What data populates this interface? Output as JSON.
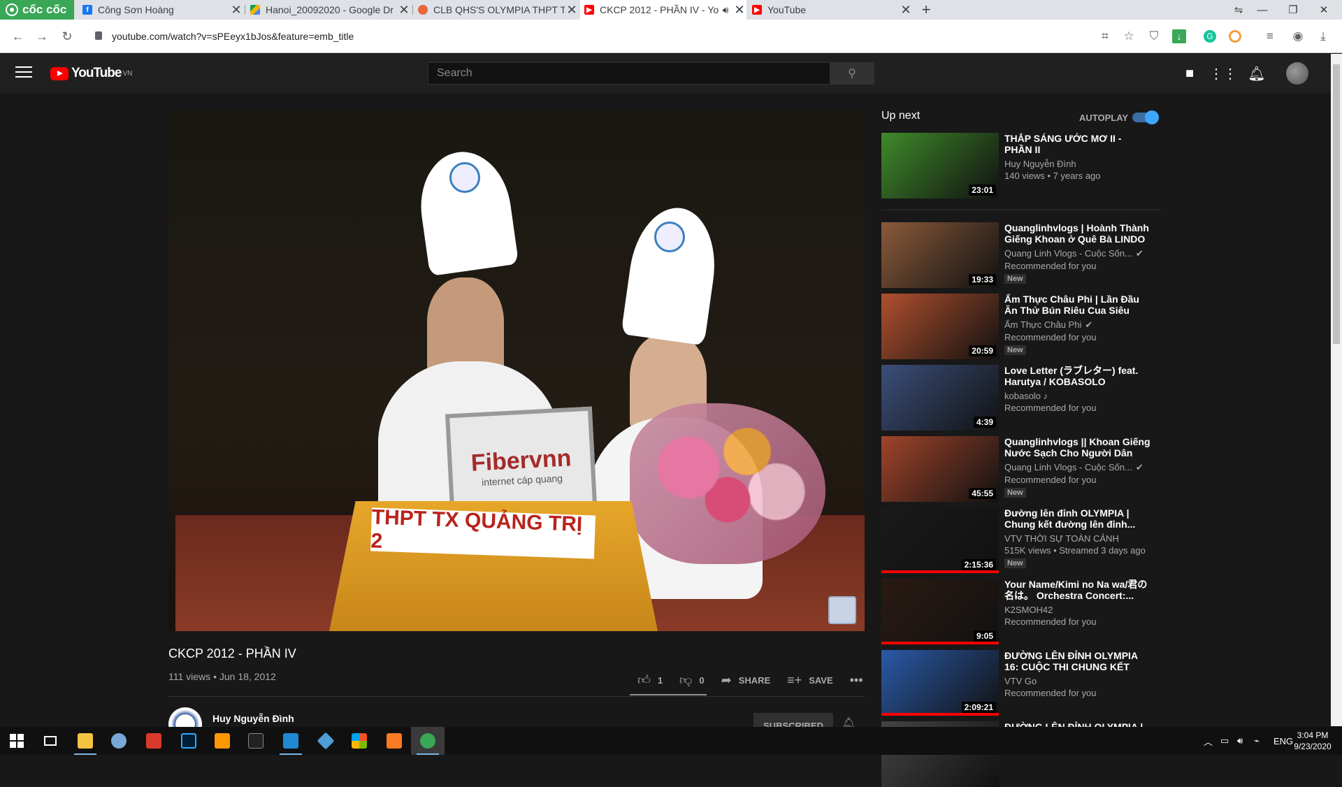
{
  "browser": {
    "brand": "cốc cốc",
    "tabs": [
      {
        "title": "Công Sơn Hoàng",
        "favicon": "facebook-icon",
        "color": "#1877f2"
      },
      {
        "title": "Hanoi_20092020 - Google Dr",
        "favicon": "google-drive-icon",
        "color": "#f4b400"
      },
      {
        "title": "CLB QHS'S OLYMPIA THPT TX",
        "favicon": "chrome-web-icon",
        "color": "#e8663d"
      },
      {
        "title": "CKCP 2012 - PHẦN IV - Yo",
        "favicon": "youtube-icon",
        "color": "#ff0000",
        "active": true
      },
      {
        "title": "YouTube",
        "favicon": "youtube-icon",
        "color": "#ff0000"
      }
    ],
    "url": "youtube.com/watch?v=sPEeyx1bJos&feature=emb_title"
  },
  "youtube": {
    "logo_text": "YouTube",
    "region": "VN",
    "search_placeholder": "Search"
  },
  "video": {
    "title": "CKCP 2012 - PHẦN IV",
    "meta": "111 views • Jun 18, 2012",
    "likes": "1",
    "dislikes": "0",
    "share_label": "SHARE",
    "save_label": "SAVE",
    "channel": "Huy Nguyễn Đình",
    "subscribe_label": "SUBSCRIBED",
    "podium_text": "THPT TX QUẢNG TRỊ 2",
    "laptop_text": "Fibervnn",
    "laptop_sub": "internet cáp quang"
  },
  "upnext": {
    "title": "Up next",
    "autoplay_label": "AUTOPLAY",
    "items": [
      {
        "title": "THẮP SÁNG ƯỚC MƠ II - PHẦN II",
        "channel": "Huy Nguyễn Đình",
        "meta": "140 views • 7 years ago",
        "duration": "23:01",
        "new": "",
        "verified": false,
        "thumb": "#3f8a2a"
      },
      {
        "title": "Quanglinhvlogs | Hoành Thành Giếng Khoan ở Quê Bà LINDO -...",
        "channel": "Quang Linh Vlogs - Cuộc Sốn...",
        "meta": "Recommended for you",
        "duration": "19:33",
        "new": "New",
        "verified": true,
        "thumb": "#8a5a3a"
      },
      {
        "title": "Ẩm Thực Châu Phi | Lần Đầu Ăn Thử Bún Riêu Cua Siêu Ngon...",
        "channel": "Ẩm Thực Châu Phi",
        "meta": "Recommended for you",
        "duration": "20:59",
        "new": "New",
        "verified": true,
        "thumb": "#b0502e"
      },
      {
        "title": "Love Letter (ラブレター) feat. Harutya / KOBASOLO",
        "channel": "kobasolo ♪",
        "meta": "Recommended for you",
        "duration": "4:39",
        "new": "",
        "verified": false,
        "thumb": "#3b4f7a"
      },
      {
        "title": "Quanglinhvlogs || Khoan Giếng Nước Sạch Cho Người Dân Bả...",
        "channel": "Quang Linh Vlogs - Cuộc Sốn...",
        "meta": "Recommended for you",
        "duration": "45:55",
        "new": "New",
        "verified": true,
        "thumb": "#a0442a"
      },
      {
        "title": "Đường lên đỉnh OLYMPIA | Chung kết đường lên đỉnh...",
        "channel": "VTV THỜI SỰ TOÀN CẢNH",
        "meta": "515K views • Streamed 3 days ago",
        "duration": "2:15:36",
        "new": "New",
        "verified": false,
        "thumb": "#1a1a1a",
        "progress": 1
      },
      {
        "title": "Your Name/Kimi no Na wa/君の名は。 Orchestra Concert:...",
        "channel": "K2SMOH42",
        "meta": "Recommended for you",
        "duration": "9:05",
        "new": "",
        "verified": false,
        "thumb": "#2a1a12",
        "progress": 1
      },
      {
        "title": "ĐƯỜNG LÊN ĐỈNH OLYMPIA 16: CUỘC THI CHUNG KẾT NĂM...",
        "channel": "VTV Go",
        "meta": "Recommended for you",
        "duration": "2:09:21",
        "new": "",
        "verified": false,
        "thumb": "#2a5aa8",
        "progress": 1
      },
      {
        "title": "ĐƯỜNG LÊN ĐỈNH OLYMPIA |",
        "channel": "",
        "meta": "",
        "duration": "",
        "new": "",
        "verified": false,
        "thumb": "#444"
      }
    ]
  },
  "taskbar": {
    "lang": "ENG",
    "time": "3:04 PM",
    "date": "9/23/2020"
  }
}
